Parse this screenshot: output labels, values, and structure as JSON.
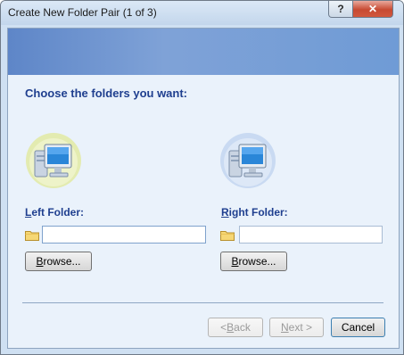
{
  "window": {
    "title": "Create New Folder Pair (1 of 3)",
    "help_glyph": "?",
    "close_glyph": "✕"
  },
  "main": {
    "heading": "Choose the folders you want:"
  },
  "left": {
    "label_accel": "L",
    "label_rest": "eft Folder:",
    "path_value": "",
    "browse_accel": "B",
    "browse_rest": "rowse..."
  },
  "right": {
    "label_accel": "R",
    "label_rest": "ight Folder:",
    "path_value": "",
    "browse_accel": "B",
    "browse_rest": "rowse..."
  },
  "footer": {
    "back_prefix": "< ",
    "back_accel": "B",
    "back_rest": "ack",
    "next_accel": "N",
    "next_rest": "ext >",
    "cancel_label": "Cancel"
  },
  "icons": {
    "left_computer": "computer-icon",
    "right_computer": "computer-icon",
    "folder": "folder-icon"
  },
  "colors": {
    "heading": "#1f3f8f",
    "banner": "#6f9bd6",
    "left_icon_glow": "#e3ebb0",
    "right_icon_glow": "#c9daf2"
  }
}
